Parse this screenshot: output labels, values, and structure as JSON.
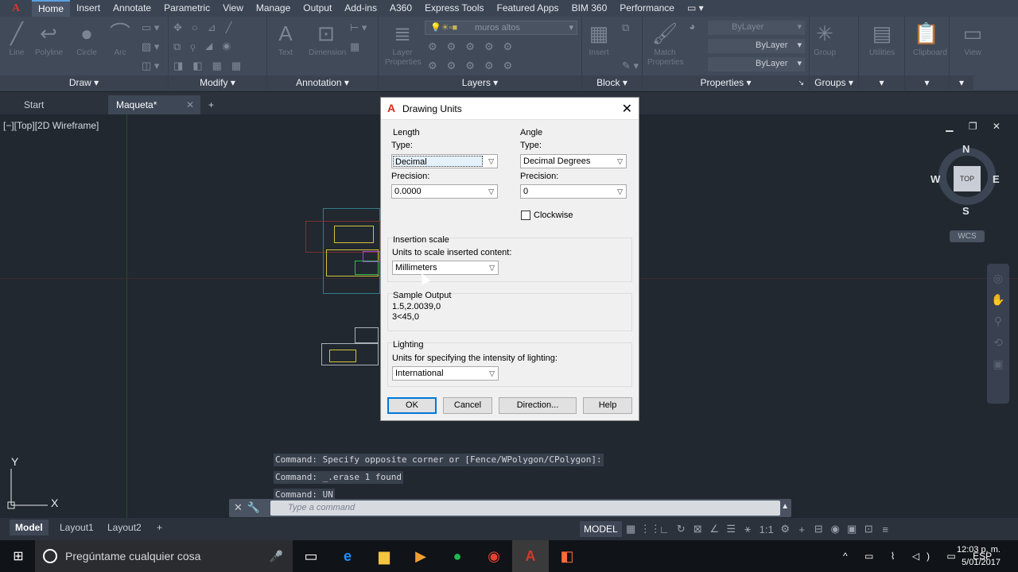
{
  "ribbon": {
    "tabs": [
      "Home",
      "Insert",
      "Annotate",
      "Parametric",
      "View",
      "Manage",
      "Output",
      "Add-ins",
      "A360",
      "Express Tools",
      "Featured Apps",
      "BIM 360",
      "Performance"
    ],
    "active_tab": "Home",
    "panels": [
      {
        "label": "Draw",
        "tools": [
          "Line",
          "Polyline",
          "Circle",
          "Arc"
        ]
      },
      {
        "label": "Modify"
      },
      {
        "label": "Annotation",
        "tools": [
          "Text",
          "Dimension"
        ]
      },
      {
        "label": "Layers",
        "tools": [
          "Layer Properties"
        ],
        "layer_name": "muros altos"
      },
      {
        "label": "Block",
        "tools": [
          "Insert"
        ]
      },
      {
        "label": "Properties",
        "tools": [
          "Match Properties"
        ],
        "by_layer": [
          "ByLayer",
          "ByLayer",
          "ByLayer"
        ]
      },
      {
        "label": "Groups",
        "tools": [
          "Group"
        ]
      },
      {
        "label": "",
        "tools": [
          "Utilities"
        ]
      },
      {
        "label": "",
        "tools": [
          "Clipboard"
        ]
      },
      {
        "label": "",
        "tools": [
          "View"
        ]
      }
    ]
  },
  "doc_tabs": [
    "Start",
    "Maqueta*"
  ],
  "viewport": {
    "control": "[−][Top][2D Wireframe]",
    "viewcube": {
      "top": "TOP",
      "n": "N",
      "s": "S",
      "e": "E",
      "w": "W"
    },
    "wcs": "WCS"
  },
  "command": {
    "history": [
      "Command: Specify opposite corner or [Fence/WPolygon/CPolygon]:",
      "Command: _.erase 1 found",
      "Command: UN"
    ],
    "placeholder": "Type a command"
  },
  "layout_tabs": [
    "Model",
    "Layout1",
    "Layout2"
  ],
  "status": {
    "model": "MODEL",
    "scale": "1:1"
  },
  "dialog": {
    "title": "Drawing Units",
    "length": {
      "group": "Length",
      "type_label": "Type:",
      "type_value": "Decimal",
      "precision_label": "Precision:",
      "precision_value": "0.0000"
    },
    "angle": {
      "group": "Angle",
      "type_label": "Type:",
      "type_value": "Decimal Degrees",
      "precision_label": "Precision:",
      "precision_value": "0",
      "clockwise_label": "Clockwise"
    },
    "insertion": {
      "group": "Insertion scale",
      "label": "Units to scale inserted content:",
      "value": "Millimeters"
    },
    "sample": {
      "group": "Sample Output",
      "line1": "1.5,2.0039,0",
      "line2": "3<45,0"
    },
    "lighting": {
      "group": "Lighting",
      "label": "Units for specifying the intensity of lighting:",
      "value": "International"
    },
    "buttons": {
      "ok": "OK",
      "cancel": "Cancel",
      "direction": "Direction...",
      "help": "Help"
    }
  },
  "taskbar": {
    "search": "Pregúntame cualquier cosa",
    "lang": "ESP",
    "time": "12:03 p. m.",
    "date": "5/01/2017"
  }
}
